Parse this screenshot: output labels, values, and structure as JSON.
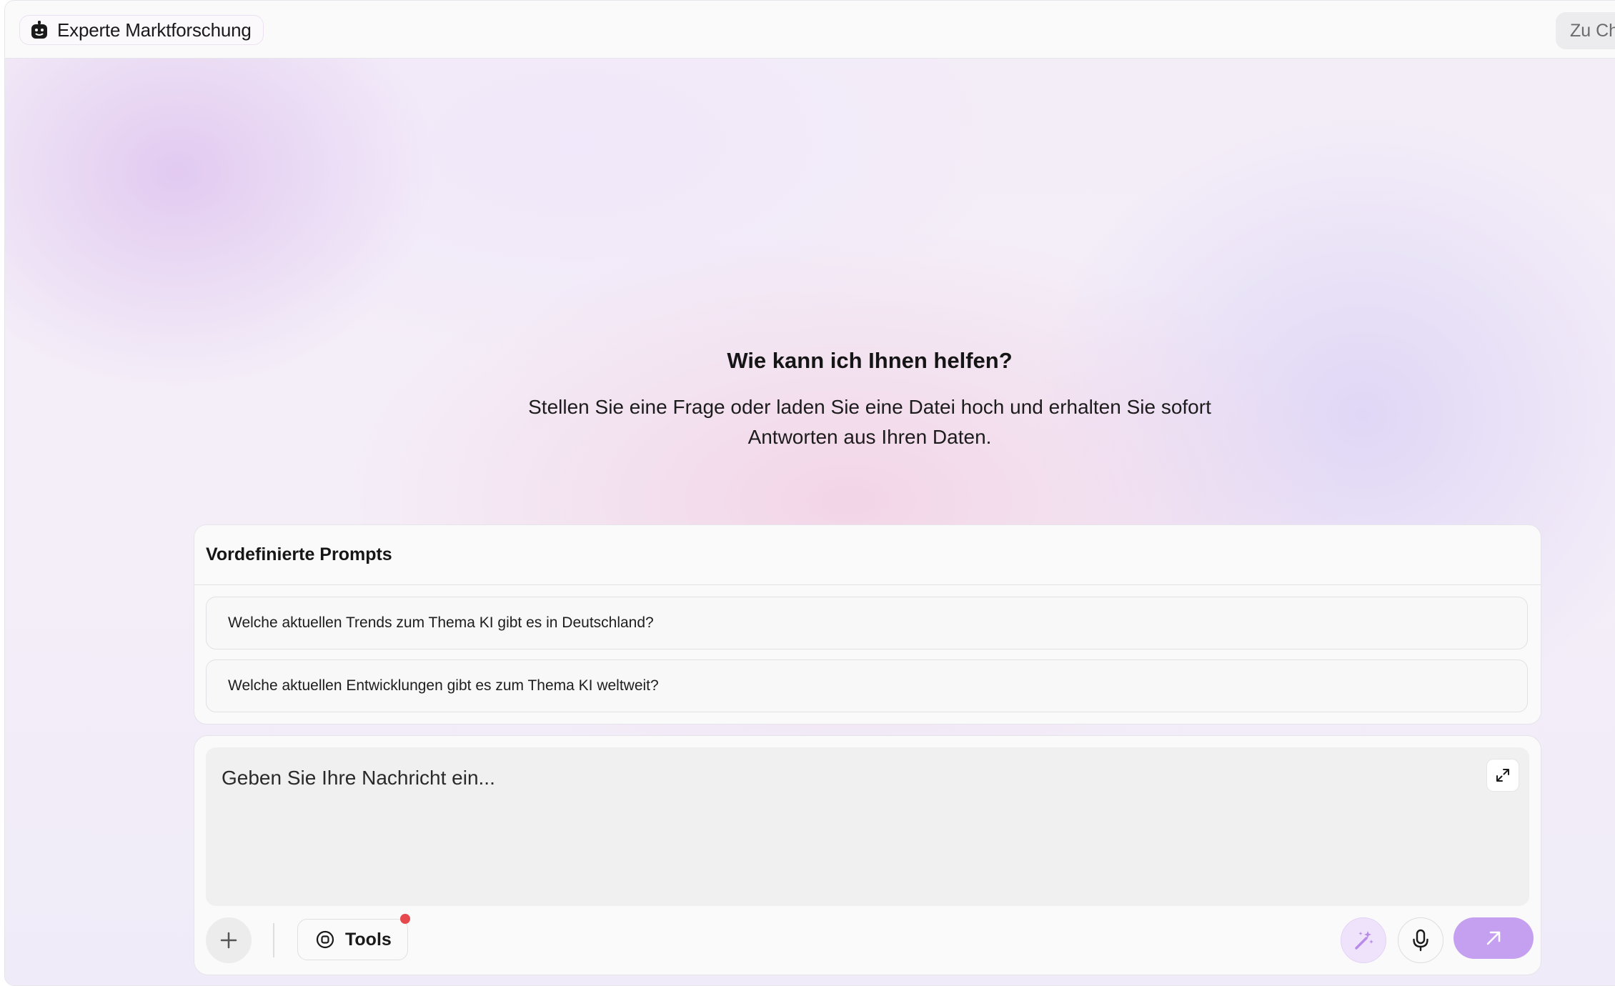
{
  "header": {
    "agent_name": "Experte Marktforschung",
    "agent_icon": "robot-icon",
    "goto_chat_label": "Zu Chat"
  },
  "hero": {
    "title": "Wie kann ich Ihnen helfen?",
    "subtitle": "Stellen Sie eine Frage oder laden Sie eine Datei hoch und erhalten Sie sofort Antworten aus Ihren Daten."
  },
  "prompts": {
    "title": "Vordefinierte Prompts",
    "items": [
      "Welche aktuellen Trends zum Thema KI gibt es in Deutschland?",
      "Welche aktuellen Entwicklungen gibt es zum Thema KI weltweit?"
    ]
  },
  "composer": {
    "placeholder": "Geben Sie Ihre Nachricht ein...",
    "tools_label": "Tools",
    "icons": {
      "expand": "expand-icon",
      "add": "plus-icon",
      "tools": "tools-icon",
      "enhance": "magic-wand-icon",
      "voice": "microphone-icon",
      "send": "arrow-up-right-icon"
    }
  },
  "colors": {
    "accent": "#c5a0f0",
    "notification_dot": "#e5484d"
  }
}
